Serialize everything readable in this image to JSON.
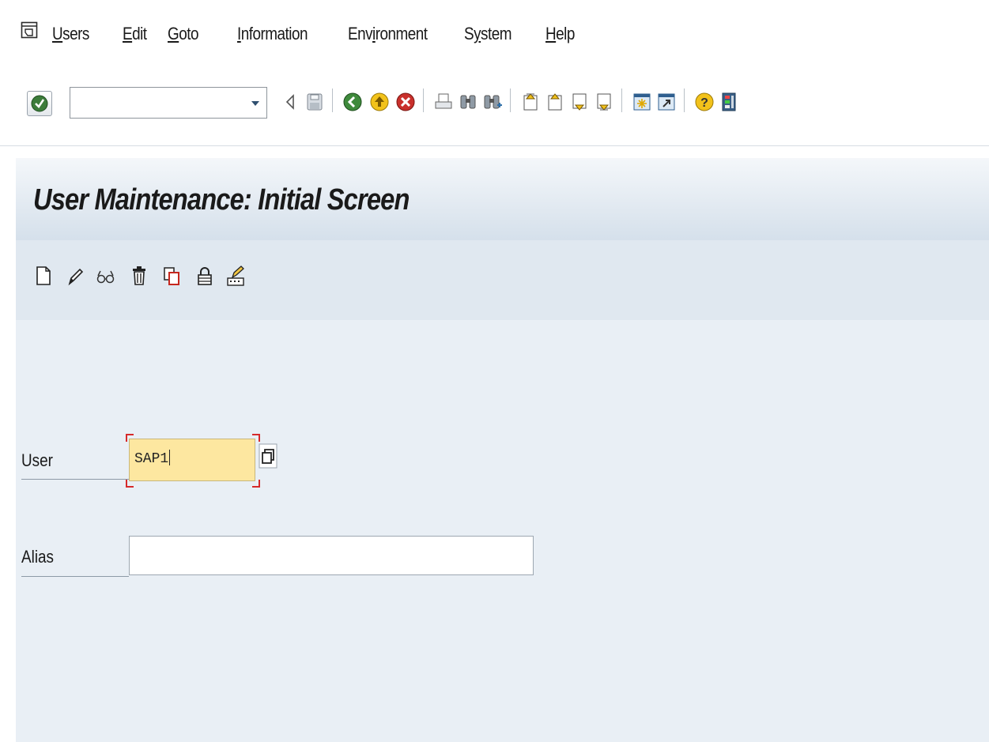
{
  "menu": {
    "icon": "menu-window-icon",
    "items": [
      {
        "name": "users",
        "underline": "U",
        "rest": "sers"
      },
      {
        "name": "edit",
        "underline": "E",
        "rest": "dit"
      },
      {
        "name": "goto",
        "underline": "G",
        "rest": "oto"
      },
      {
        "name": "information",
        "underline": "I",
        "rest": "nformation"
      },
      {
        "name": "environment",
        "pre": "Env",
        "underline": "i",
        "rest": "ronment"
      },
      {
        "name": "system",
        "pre": "S",
        "underline": "y",
        "rest": "stem"
      },
      {
        "name": "help",
        "underline": "H",
        "rest": "elp"
      }
    ]
  },
  "toolbar": {
    "command_field_value": "",
    "icons": [
      "enter-check-icon",
      "dropdown-arrow-icon",
      "collapse-icon",
      "save-icon",
      "back-icon",
      "exit-icon",
      "cancel-icon",
      "print-icon",
      "find-icon",
      "find-next-icon",
      "first-page-icon",
      "previous-page-icon",
      "next-page-icon",
      "last-page-icon",
      "new-session-icon",
      "create-shortcut-icon",
      "help-icon",
      "customize-layout-icon"
    ]
  },
  "page": {
    "title": "User Maintenance: Initial Screen"
  },
  "app_toolbar": {
    "icons": [
      "create-icon",
      "change-icon",
      "display-icon",
      "delete-icon",
      "copy-icon",
      "lock-icon",
      "change-password-icon"
    ]
  },
  "form": {
    "user_label": "User",
    "user_value": "SAP1",
    "alias_label": "Alias",
    "alias_value": ""
  },
  "colors": {
    "title_band": "#d5e0eb",
    "content_bg": "#e9eff5",
    "required_field_bg": "#fde7a0",
    "required_marker": "#d62a2a"
  }
}
